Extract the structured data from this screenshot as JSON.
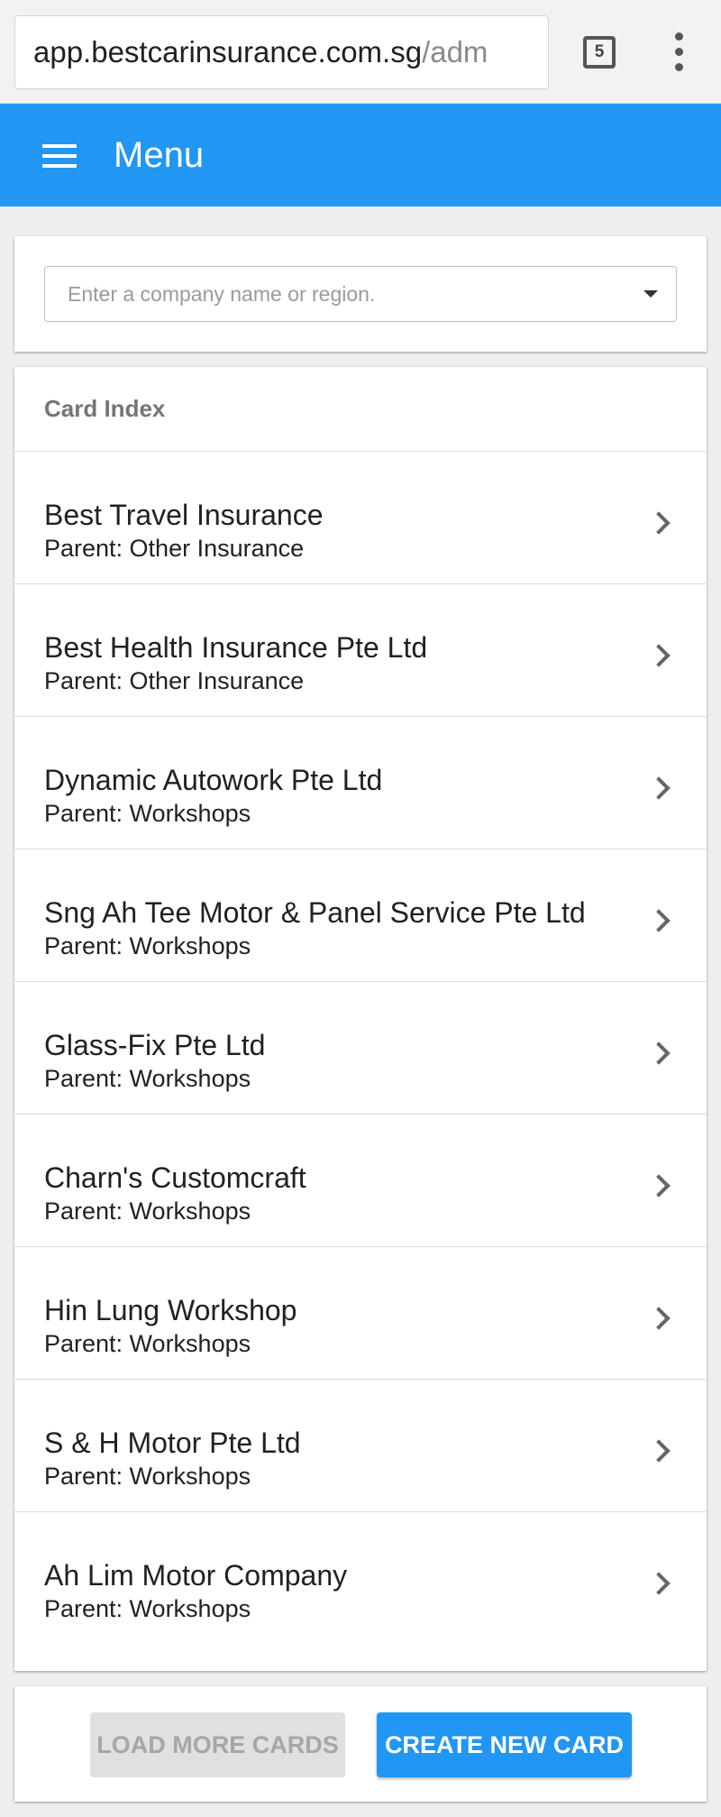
{
  "browser": {
    "url_domain": "app.bestcarinsurance.com.sg",
    "url_path": "/adm",
    "tab_count": "5",
    "menu_icon": "more-vertical-icon"
  },
  "app_bar": {
    "menu_icon": "hamburger-icon",
    "title": "Menu",
    "color": "#2196f3"
  },
  "search": {
    "placeholder": "Enter a company name or region.",
    "icon": "dropdown-arrow-icon"
  },
  "card_index": {
    "header": "Card Index",
    "items": [
      {
        "name": "Best Travel Insurance",
        "parent": "Parent: Other Insurance"
      },
      {
        "name": "Best Health Insurance Pte Ltd",
        "parent": "Parent: Other Insurance"
      },
      {
        "name": "Dynamic Autowork Pte Ltd",
        "parent": "Parent: Workshops"
      },
      {
        "name": "Sng Ah Tee Motor & Panel Service Pte Ltd",
        "parent": "Parent: Workshops"
      },
      {
        "name": "Glass-Fix Pte Ltd",
        "parent": "Parent: Workshops"
      },
      {
        "name": "Charn's Customcraft",
        "parent": "Parent: Workshops"
      },
      {
        "name": "Hin Lung Workshop",
        "parent": "Parent: Workshops"
      },
      {
        "name": "S & H Motor Pte Ltd",
        "parent": "Parent: Workshops"
      },
      {
        "name": "Ah Lim Motor Company",
        "parent": "Parent: Workshops"
      }
    ]
  },
  "actions": {
    "load_more_label": "LOAD MORE CARDS",
    "create_label": "CREATE NEW CARD"
  }
}
